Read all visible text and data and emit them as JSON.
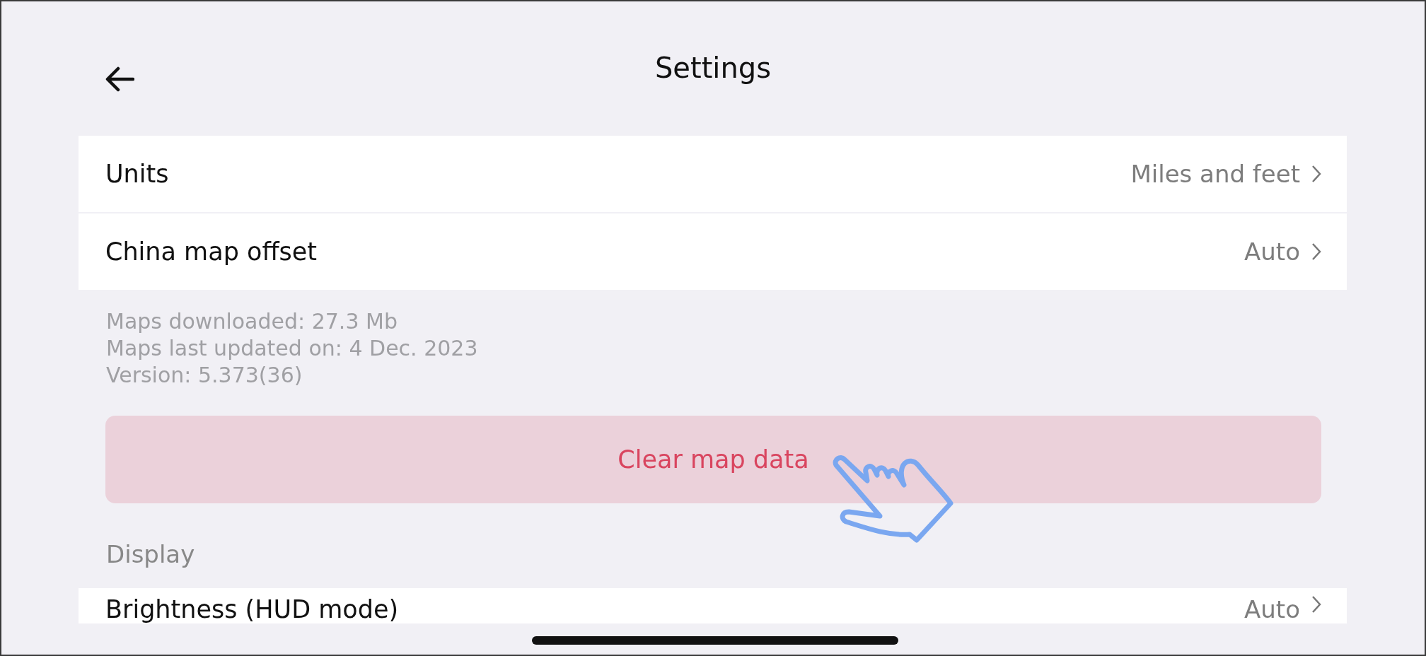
{
  "header": {
    "title": "Settings"
  },
  "map_settings": [
    {
      "label": "Units",
      "value": "Miles and feet"
    },
    {
      "label": "China map offset",
      "value": "Auto"
    }
  ],
  "map_info": [
    "Maps downloaded: 27.3 Mb",
    "Maps last updated on: 4 Dec. 2023",
    "Version: 5.373(36)"
  ],
  "clear_button": {
    "label": "Clear map data"
  },
  "display_section": {
    "title": "Display",
    "rows": [
      {
        "label": "Brightness (HUD mode)",
        "value": "Auto"
      }
    ]
  }
}
